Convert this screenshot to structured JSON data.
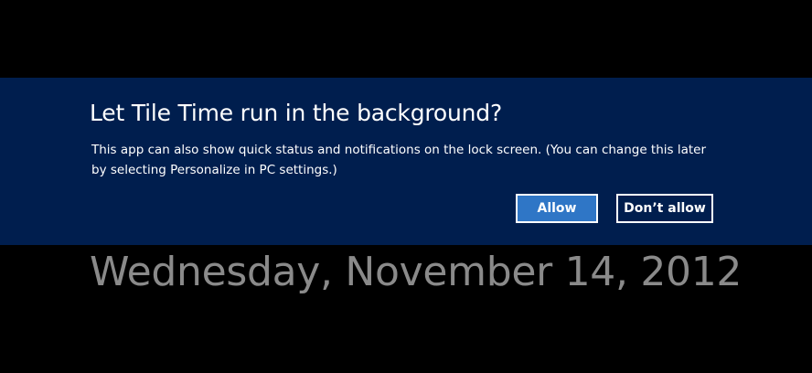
{
  "dialog": {
    "title": "Let Tile Time run in the background?",
    "message": "This app can also show quick status and notifications on the lock screen. (You can change this later by selecting Personalize in PC settings.)",
    "allow_label": "Allow",
    "deny_label": "Don’t allow"
  },
  "lock_screen": {
    "date": "Wednesday, November 14, 2012"
  },
  "colors": {
    "dialog_background": "#001e4e",
    "allow_button": "#2f76c6",
    "date_text": "#8a8a8a"
  }
}
